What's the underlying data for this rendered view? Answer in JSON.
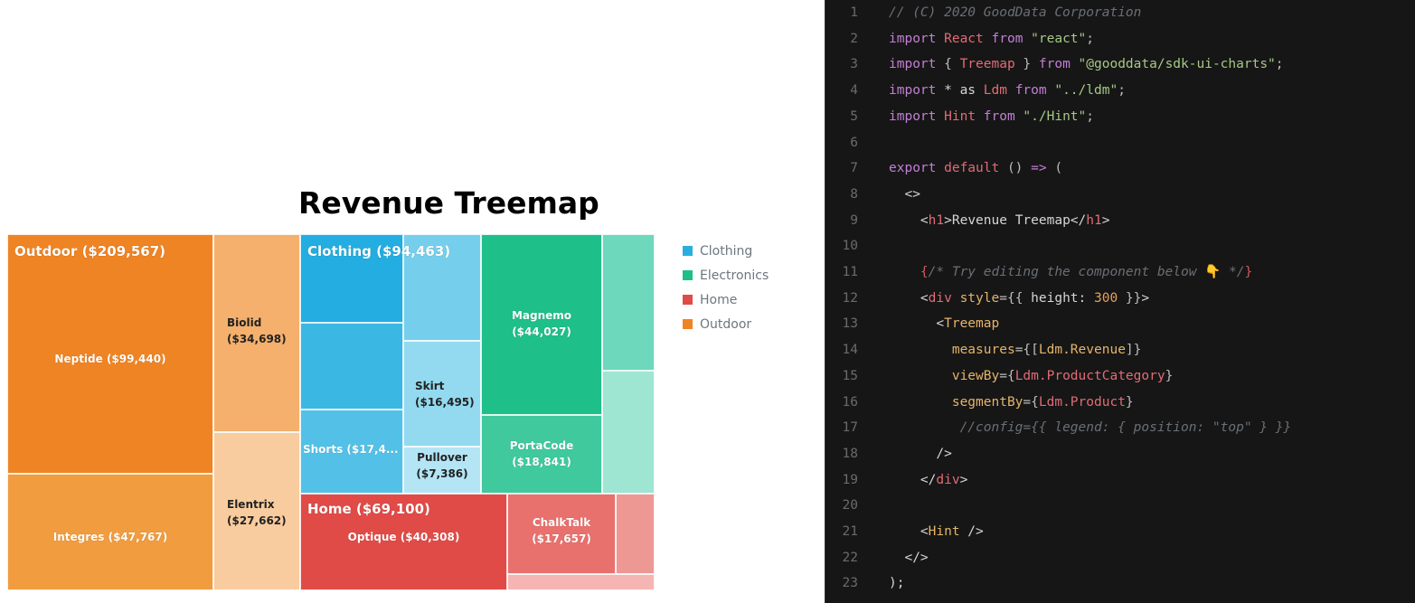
{
  "chart_data": {
    "type": "treemap",
    "title": "Revenue Treemap",
    "legend": {
      "position": "right",
      "entries": [
        {
          "label": "Clothing",
          "color": "#2aaee0"
        },
        {
          "label": "Electronics",
          "color": "#1fbf8a"
        },
        {
          "label": "Home",
          "color": "#e14b47"
        },
        {
          "label": "Outdoor",
          "color": "#ef8424"
        }
      ]
    },
    "categories": [
      {
        "name": "Outdoor",
        "label": "Outdoor ($209,567)",
        "value": 209567,
        "color": "#ef8424",
        "children": [
          {
            "name": "Neptide",
            "label": "Neptide ($99,440)",
            "value": 99440,
            "color": "#ef8424",
            "text": "light"
          },
          {
            "name": "Integres",
            "label": "Integres ($47,767)",
            "value": 47767,
            "color": "#f19c3e",
            "text": "light"
          },
          {
            "name": "Biolid",
            "label": "Biolid\n($34,698)",
            "value": 34698,
            "color": "#f4b06c",
            "text": "dark"
          },
          {
            "name": "Elentrix",
            "label": "Elentrix\n($27,662)",
            "value": 27662,
            "color": "#f8cc9e",
            "text": "dark"
          }
        ]
      },
      {
        "name": "Clothing",
        "label": "Clothing ($94,463)",
        "value": 94463,
        "color": "#2aaee0",
        "children": [
          {
            "name": "",
            "label": "",
            "value": 19500,
            "color": "#23ade0",
            "text": "light"
          },
          {
            "name": "",
            "label": "",
            "value": 18800,
            "color": "#3ab8e3",
            "text": "light"
          },
          {
            "name": "Shorts",
            "label": "Shorts ($17,4...",
            "value": 17400,
            "color": "#53c1e7",
            "text": "light"
          },
          {
            "name": "",
            "label": "",
            "value": 14900,
            "color": "#75cfec",
            "text": "light"
          },
          {
            "name": "Skirt",
            "label": "Skirt\n($16,495)",
            "value": 16495,
            "color": "#93daf0",
            "text": "dark"
          },
          {
            "name": "Pullover",
            "label": "Pullover\n($7,386)",
            "value": 7386,
            "color": "#b3e5f5",
            "text": "dark"
          }
        ]
      },
      {
        "name": "Electronics",
        "label": "",
        "value": 98000,
        "color": "#1fbf8a",
        "children": [
          {
            "name": "Magnemo",
            "label": "Magnemo\n($44,027)",
            "value": 44027,
            "color": "#1fbf8a",
            "text": "light"
          },
          {
            "name": "PortaCode",
            "label": "PortaCode\n($18,841)",
            "value": 18841,
            "color": "#40c99d",
            "text": "light"
          },
          {
            "name": "",
            "label": "",
            "value": 18000,
            "color": "#6dd8bc",
            "text": "light"
          },
          {
            "name": "",
            "label": "",
            "value": 16500,
            "color": "#9ee5d2",
            "text": "light"
          }
        ]
      },
      {
        "name": "Home",
        "label": "Home ($69,100)",
        "value": 69100,
        "color": "#e14b47",
        "children": [
          {
            "name": "Optique",
            "label": "Optique ($40,308)",
            "value": 40308,
            "color": "#e14b47",
            "text": "light"
          },
          {
            "name": "ChalkTalk",
            "label": "ChalkTalk\n($17,657)",
            "value": 17657,
            "color": "#e8716d",
            "text": "light"
          },
          {
            "name": "",
            "label": "",
            "value": 6600,
            "color": "#ee9894",
            "text": "light"
          },
          {
            "name": "",
            "label": "",
            "value": 4500,
            "color": "#f5b6b3",
            "text": "light"
          }
        ]
      }
    ]
  },
  "editor": {
    "lines": [
      {
        "n": "1",
        "tokens": [
          [
            "tk-comment",
            "// (C) 2020 GoodData Corporation"
          ]
        ]
      },
      {
        "n": "2",
        "tokens": [
          [
            "tk-keyword",
            "import "
          ],
          [
            "tk-ident",
            "React "
          ],
          [
            "tk-keyword",
            "from "
          ],
          [
            "tk-string",
            "\"react\""
          ],
          [
            "tk-punct",
            ";"
          ]
        ]
      },
      {
        "n": "3",
        "tokens": [
          [
            "tk-keyword",
            "import "
          ],
          [
            "tk-punct",
            "{ "
          ],
          [
            "tk-ident",
            "Treemap "
          ],
          [
            "tk-punct",
            "} "
          ],
          [
            "tk-keyword",
            "from "
          ],
          [
            "tk-string",
            "\"@gooddata/sdk-ui-charts\""
          ],
          [
            "tk-punct",
            ";"
          ]
        ]
      },
      {
        "n": "4",
        "tokens": [
          [
            "tk-keyword",
            "import "
          ],
          [
            "tk-plain",
            "* as "
          ],
          [
            "tk-ident",
            "Ldm "
          ],
          [
            "tk-keyword",
            "from "
          ],
          [
            "tk-string",
            "\"../ldm\""
          ],
          [
            "tk-punct",
            ";"
          ]
        ]
      },
      {
        "n": "5",
        "tokens": [
          [
            "tk-keyword",
            "import "
          ],
          [
            "tk-ident",
            "Hint "
          ],
          [
            "tk-keyword",
            "from "
          ],
          [
            "tk-string",
            "\"./Hint\""
          ],
          [
            "tk-punct",
            ";"
          ]
        ]
      },
      {
        "n": "6",
        "tokens": []
      },
      {
        "n": "7",
        "tokens": [
          [
            "tk-keyword",
            "export "
          ],
          [
            "tk-ident",
            "default "
          ],
          [
            "tk-punct",
            "() "
          ],
          [
            "tk-keyword",
            "=> "
          ],
          [
            "tk-punct",
            "("
          ]
        ]
      },
      {
        "n": "8",
        "tokens": [
          [
            "tk-plain",
            "  <>"
          ]
        ]
      },
      {
        "n": "9",
        "tokens": [
          [
            "tk-plain",
            "    <"
          ],
          [
            "tk-tag",
            "h1"
          ],
          [
            "tk-plain",
            ">Revenue Treemap</"
          ],
          [
            "tk-tag",
            "h1"
          ],
          [
            "tk-plain",
            ">"
          ]
        ]
      },
      {
        "n": "10",
        "tokens": []
      },
      {
        "n": "11",
        "tokens": [
          [
            "tk-plain",
            "    "
          ],
          [
            "tk-bracket-red",
            "{"
          ],
          [
            "tk-comment",
            "/* Try editing the component below "
          ],
          [
            "tk-emoji",
            "👇"
          ],
          [
            "tk-comment",
            " */"
          ],
          [
            "tk-bracket-red",
            "}"
          ]
        ]
      },
      {
        "n": "12",
        "tokens": [
          [
            "tk-plain",
            "    <"
          ],
          [
            "tk-tag",
            "div "
          ],
          [
            "tk-attr",
            "style"
          ],
          [
            "tk-punct",
            "={{ "
          ],
          [
            "tk-plain",
            "height: "
          ],
          [
            "tk-number",
            "300"
          ],
          [
            "tk-punct",
            " }}"
          ],
          [
            "tk-plain",
            ">"
          ]
        ]
      },
      {
        "n": "13",
        "tokens": [
          [
            "tk-plain",
            "      <"
          ],
          [
            "tk-component",
            "Treemap"
          ]
        ]
      },
      {
        "n": "14",
        "tokens": [
          [
            "tk-plain",
            "        "
          ],
          [
            "tk-attr",
            "measures"
          ],
          [
            "tk-punct",
            "={["
          ],
          [
            "tk-component",
            "Ldm.Revenue"
          ],
          [
            "tk-punct",
            "]}"
          ]
        ]
      },
      {
        "n": "15",
        "tokens": [
          [
            "tk-plain",
            "        "
          ],
          [
            "tk-attr",
            "viewBy"
          ],
          [
            "tk-punct",
            "={"
          ],
          [
            "tk-ident",
            "Ldm.ProductCategory"
          ],
          [
            "tk-punct",
            "}"
          ]
        ]
      },
      {
        "n": "16",
        "tokens": [
          [
            "tk-plain",
            "        "
          ],
          [
            "tk-attr",
            "segmentBy"
          ],
          [
            "tk-punct",
            "={"
          ],
          [
            "tk-ident",
            "Ldm.Product"
          ],
          [
            "tk-punct",
            "}"
          ]
        ]
      },
      {
        "n": "17",
        "tokens": [
          [
            "tk-plain",
            "         "
          ],
          [
            "tk-comment",
            "//config={{ legend: { position: \"top\" } }}"
          ]
        ]
      },
      {
        "n": "18",
        "tokens": [
          [
            "tk-plain",
            "      />"
          ]
        ]
      },
      {
        "n": "19",
        "tokens": [
          [
            "tk-plain",
            "    </"
          ],
          [
            "tk-tag",
            "div"
          ],
          [
            "tk-plain",
            ">"
          ]
        ]
      },
      {
        "n": "20",
        "tokens": []
      },
      {
        "n": "21",
        "tokens": [
          [
            "tk-plain",
            "    <"
          ],
          [
            "tk-component",
            "Hint"
          ],
          [
            "tk-plain",
            " />"
          ]
        ]
      },
      {
        "n": "22",
        "tokens": [
          [
            "tk-plain",
            "  </>"
          ]
        ]
      },
      {
        "n": "23",
        "tokens": [
          [
            "tk-plain",
            ");"
          ]
        ]
      }
    ]
  }
}
